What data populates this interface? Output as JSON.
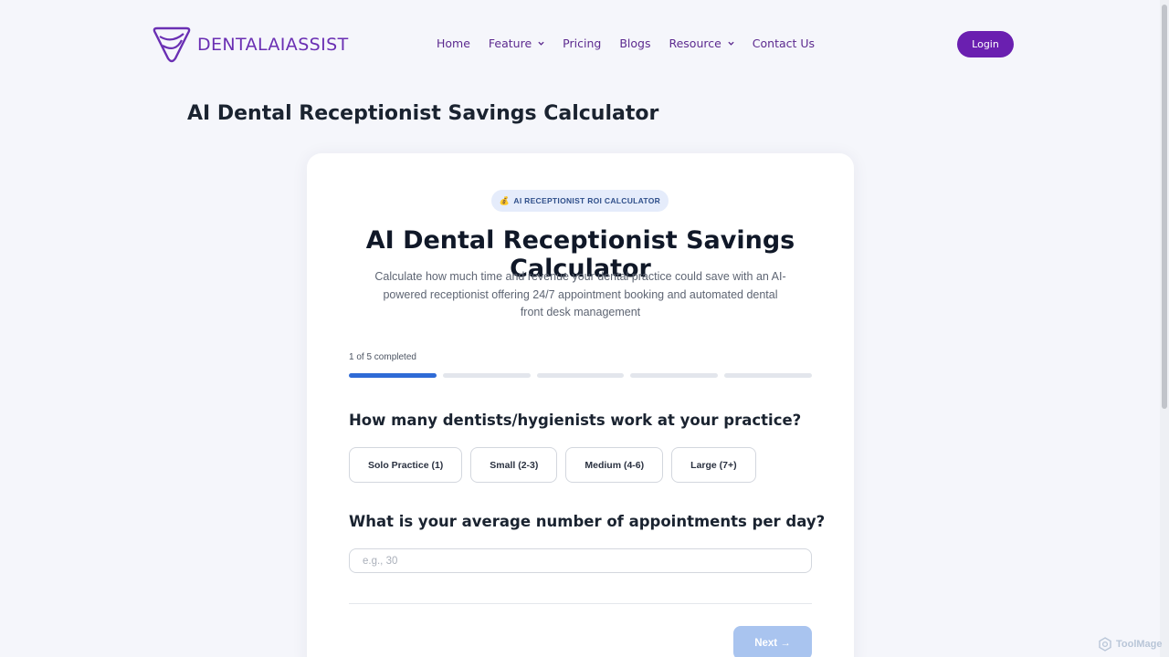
{
  "header": {
    "brand": "DENTALAIASSIST",
    "nav": [
      {
        "label": "Home",
        "dropdown": false
      },
      {
        "label": "Feature",
        "dropdown": true
      },
      {
        "label": "Pricing",
        "dropdown": false
      },
      {
        "label": "Blogs",
        "dropdown": false
      },
      {
        "label": "Resource",
        "dropdown": true
      },
      {
        "label": "Contact Us",
        "dropdown": false
      }
    ],
    "login_label": "Login"
  },
  "page_title": "AI Dental Receptionist Savings Calculator",
  "card": {
    "badge_icon": "money-bag-icon",
    "badge_emoji": "💰",
    "badge_label": "AI RECEPTIONIST ROI CALCULATOR",
    "title": "AI Dental Receptionist Savings Calculator",
    "subtitle": "Calculate how much time and revenue your dental practice could save with an AI-powered receptionist offering 24/7 appointment booking and automated dental front desk management",
    "progress": {
      "label": "1 of 5 completed",
      "completed": 1,
      "total": 5
    },
    "question1": "How many dentists/hygienists work at your practice?",
    "options": [
      "Solo Practice (1)",
      "Small (2-3)",
      "Medium (4-6)",
      "Large (7+)"
    ],
    "question2": "What is your average number of appointments per day?",
    "appointments_placeholder": "e.g., 30",
    "appointments_value": "",
    "next_label": "Next →"
  },
  "watermark": "ToolMage",
  "colors": {
    "brand_purple": "#6a1fb0",
    "progress_blue": "#2f6bd6",
    "next_disabled": "#a9c4ef",
    "background": "#f5f6fb"
  }
}
